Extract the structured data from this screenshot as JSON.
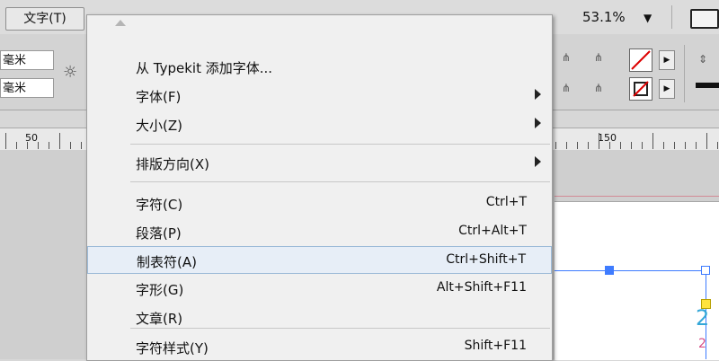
{
  "menubar": {
    "text_menu": "文字(T)",
    "zoom": "53.1%"
  },
  "controlbar": {
    "unit1": "毫米",
    "unit2": "毫米"
  },
  "ruler": {
    "marks": [
      "50",
      "150"
    ]
  },
  "menu": {
    "items": [
      {
        "label": "从 Typekit 添加字体...",
        "shortcut": "",
        "submenu": false
      },
      {
        "label": "字体(F)",
        "shortcut": "",
        "submenu": true
      },
      {
        "label": "大小(Z)",
        "shortcut": "",
        "submenu": true
      },
      {
        "label": "排版方向(X)",
        "shortcut": "",
        "submenu": true
      },
      {
        "label": "字符(C)",
        "shortcut": "Ctrl+T",
        "submenu": false
      },
      {
        "label": "段落(P)",
        "shortcut": "Ctrl+Alt+T",
        "submenu": false
      },
      {
        "label": "制表符(A)",
        "shortcut": "Ctrl+Shift+T",
        "submenu": false,
        "highlighted": true
      },
      {
        "label": "字形(G)",
        "shortcut": "Alt+Shift+F11",
        "submenu": false
      },
      {
        "label": "文章(R)",
        "shortcut": "",
        "submenu": false
      },
      {
        "label": "字符样式(Y)",
        "shortcut": "Shift+F11",
        "submenu": false
      }
    ]
  },
  "page": {
    "digit": "2",
    "digit_small": "2"
  },
  "colors": {
    "accent": "#3f7cff",
    "highlight_bg": "#e7eef7"
  }
}
